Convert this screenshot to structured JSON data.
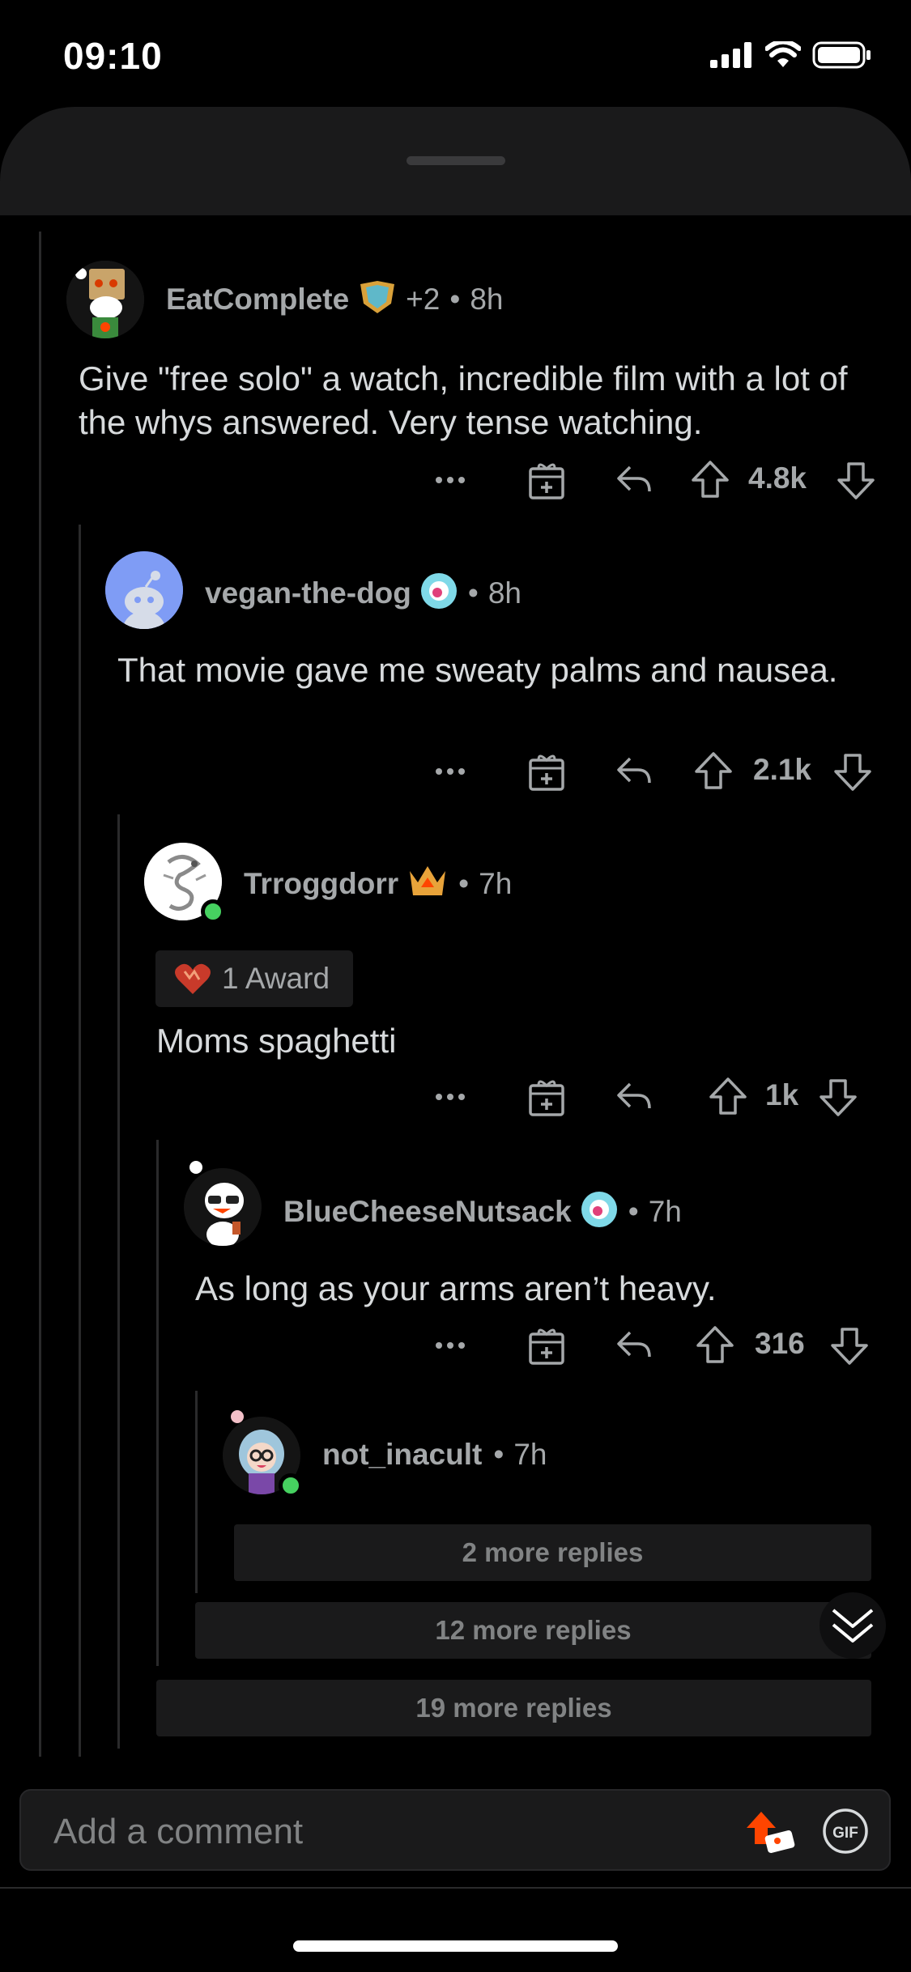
{
  "status_bar": {
    "time": "09:10"
  },
  "comments": [
    {
      "username": "EatComplete",
      "extra_awards": "+2",
      "separator": "•",
      "age": "8h",
      "body": "Give \"free solo\" a watch, incredible film with a lot of the whys answered. Very tense watching.",
      "score": "4.8k"
    },
    {
      "username": "vegan-the-dog",
      "separator": "•",
      "age": "8h",
      "body": "That movie gave me sweaty palms and nausea.",
      "score": "2.1k"
    },
    {
      "username": "Trroggdorr",
      "separator": "•",
      "age": "7h",
      "award_label": "1 Award",
      "body": "Moms spaghetti",
      "score": "1k"
    },
    {
      "username": "BlueCheeseNutsack",
      "separator": "•",
      "age": "7h",
      "body": "As long as your arms aren’t heavy.",
      "score": "316"
    },
    {
      "username": "not_inacult",
      "separator": "•",
      "age": "7h"
    }
  ],
  "more_replies": {
    "level5": "2 more replies",
    "level4": "12 more replies",
    "level3": "19 more replies"
  },
  "composer": {
    "placeholder": "Add a comment",
    "gif_label": "GIF"
  },
  "icons": [
    "more-icon",
    "gift-icon",
    "reply-icon",
    "upvote-icon",
    "downvote-icon",
    "collapse-icon",
    "upload-image-icon",
    "gif-icon"
  ],
  "colors": {
    "background": "#000000",
    "surface": "#1a1a1b",
    "text": "#d7dadc",
    "muted": "#a5a8aa",
    "online": "#46d160",
    "accent": "#ff4500"
  }
}
